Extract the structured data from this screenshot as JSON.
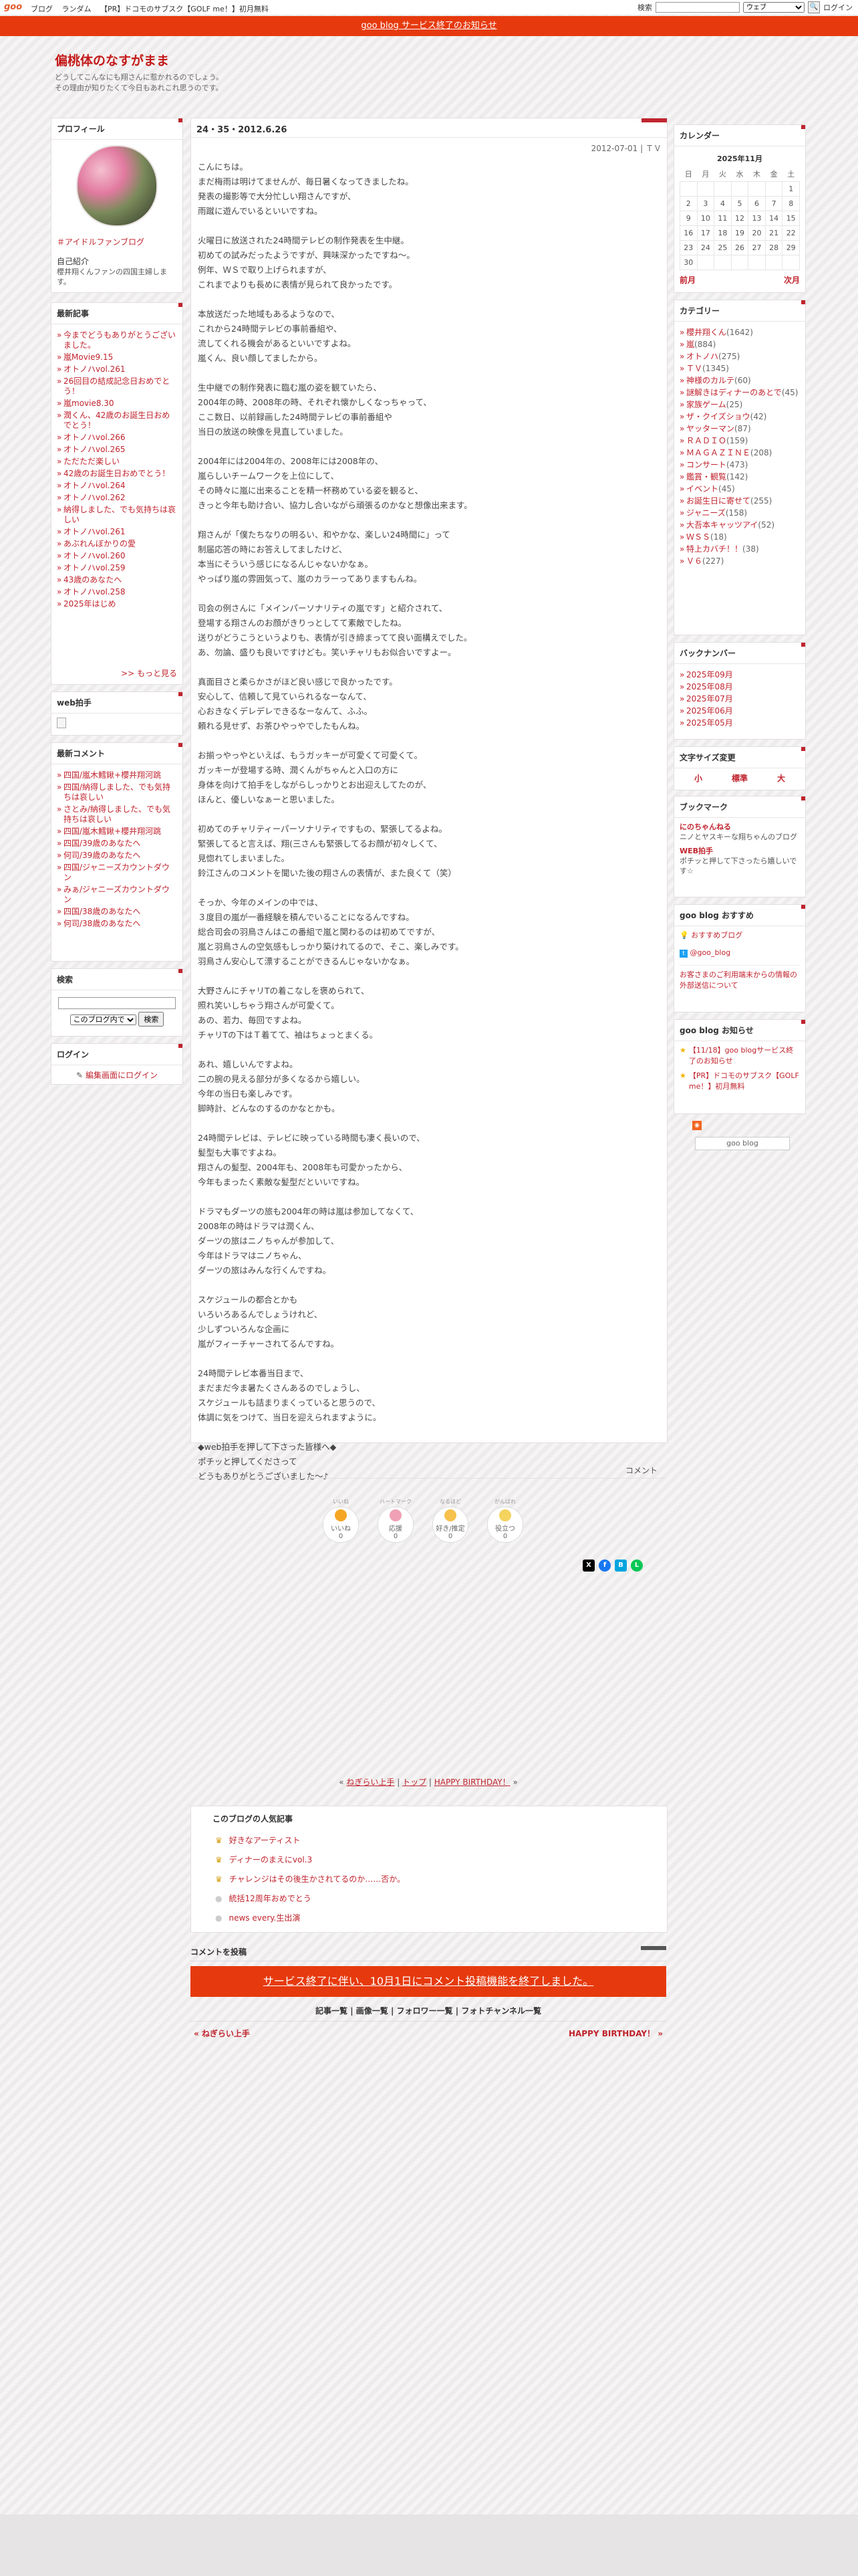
{
  "topbar": {
    "logo": "goo",
    "nav": [
      "ブログ",
      "ランダム",
      "【PR】ドコモのサブスク【GOLF me！】初月無料"
    ],
    "search_label": "検索",
    "search_scope": "ウェブ",
    "login": "ログイン"
  },
  "notice": "goo blog サービス終了のお知らせ",
  "blog": {
    "title": "偏桃体のなすがまま",
    "desc1": "どうしてこんなにも翔さんに惹かれるのでしょう。",
    "desc2": "その理由が知りたくて今日もあれこれ思うのです。"
  },
  "profile": {
    "heading": "プロフィール",
    "tag": "＃アイドルファンブログ",
    "intro_label": "自己紹介",
    "intro": "櫻井翔くんファンの四国主婦します。"
  },
  "recent": {
    "heading": "最新記事",
    "items": [
      "今までどうもありがとうございました。",
      "嵐Movie9.15",
      "オトノハvol.261",
      "26回目の結成記念日おめでとう！",
      "嵐movie8.30",
      "潤くん、42歳のお誕生日おめでとう！",
      "オトノハvol.266",
      "オトノハvol.265",
      "ただただ楽しい",
      "42歳のお誕生日おめでとう！",
      "オトノハvol.264",
      "オトノハvol.262",
      "納得しました、でも気持ちは哀しい",
      "オトノハvol.261",
      "あぶれんぼかりの愛",
      "オトノハvol.260",
      "オトノハvol.259",
      "43歳のあなたへ",
      "オトノハvol.258",
      "2025年はじめ"
    ],
    "more": ">> もっと見る"
  },
  "webclap": {
    "heading": "web拍手"
  },
  "comments": {
    "heading": "最新コメント",
    "items": [
      "四国/嵐木鱈鍬+櫻井翔河跳",
      "四国/納得しました、でも気持ちは哀しい",
      "さとみ/納得しました、でも気持ちは哀しい",
      "四国/嵐木鱈鍬+櫻井翔河跳",
      "四国/39歳のあなたへ",
      "何司/39歳のあなたへ",
      "四国/ジャニーズカウントダウン",
      "みぁ/ジャニーズカウントダウン",
      "四国/38歳のあなたへ",
      "何司/38歳のあなたへ"
    ]
  },
  "search": {
    "heading": "検索",
    "scope": "このブログ内で",
    "button": "検索"
  },
  "login": {
    "heading": "ログイン",
    "link": "編集画面にログイン"
  },
  "calendar": {
    "heading": "カレンダー",
    "month": "2025年11月",
    "days": [
      "日",
      "月",
      "火",
      "水",
      "木",
      "金",
      "土"
    ],
    "weeks": [
      [
        "",
        "",
        "",
        "",
        "",
        "",
        "1"
      ],
      [
        "2",
        "3",
        "4",
        "5",
        "6",
        "7",
        "8"
      ],
      [
        "9",
        "10",
        "11",
        "12",
        "13",
        "14",
        "15"
      ],
      [
        "16",
        "17",
        "18",
        "19",
        "20",
        "21",
        "22"
      ],
      [
        "23",
        "24",
        "25",
        "26",
        "27",
        "28",
        "29"
      ],
      [
        "30",
        "",
        "",
        "",
        "",
        "",
        ""
      ]
    ],
    "prev": "前月",
    "next": "次月"
  },
  "category": {
    "heading": "カテゴリー",
    "items": [
      {
        "name": "櫻井翔くん",
        "count": "(1642)"
      },
      {
        "name": "嵐",
        "count": "(884)"
      },
      {
        "name": "オトノハ",
        "count": "(275)"
      },
      {
        "name": "ＴＶ",
        "count": "(1345)"
      },
      {
        "name": "神様のカルテ",
        "count": "(60)"
      },
      {
        "name": "謎解きはディナーのあとで",
        "count": "(45)"
      },
      {
        "name": "家族ゲーム",
        "count": "(25)"
      },
      {
        "name": "ザ・クイズショウ",
        "count": "(42)"
      },
      {
        "name": "ヤッターマン",
        "count": "(87)"
      },
      {
        "name": "ＲＡＤＩＯ",
        "count": "(159)"
      },
      {
        "name": "ＭＡＧＡＺＩＮＥ",
        "count": "(208)"
      },
      {
        "name": "コンサート",
        "count": "(473)"
      },
      {
        "name": "鑑賞・観覧",
        "count": "(142)"
      },
      {
        "name": "イベント",
        "count": "(45)"
      },
      {
        "name": "お誕生日に寄せて",
        "count": "(255)"
      },
      {
        "name": "ジャニーズ",
        "count": "(158)"
      },
      {
        "name": "大吾本キャッツアイ",
        "count": "(52)"
      },
      {
        "name": "ＷＳＳ",
        "count": "(18)"
      },
      {
        "name": "特上カバチ！！",
        "count": "(38)"
      },
      {
        "name": "Ｖ６",
        "count": "(227)"
      }
    ]
  },
  "backnumber": {
    "heading": "バックナンバー",
    "items": [
      "2025年09月",
      "2025年08月",
      "2025年07月",
      "2025年06月",
      "2025年05月"
    ]
  },
  "fontsize": {
    "heading": "文字サイズ変更",
    "small": "小",
    "medium": "標準",
    "large": "大"
  },
  "bookmark": {
    "heading": "ブックマーク",
    "items": [
      {
        "name": "にのちゃんねる",
        "desc": "ニノとヤスキーな翔ちゃんのブログ"
      },
      {
        "name": "WEB拍手",
        "desc": "ポチッと押して下さったら嬉しいです☆"
      }
    ]
  },
  "recommend": {
    "heading": "goo blog おすすめ",
    "item1": "おすすめブログ",
    "item2": "@goo_blog",
    "notice": "お客さまのご利用端末からの情報の外部送信について"
  },
  "news": {
    "heading": "goo blog お知らせ",
    "items": [
      "【11/18】goo blogサービス終了のお知らせ",
      "【PR】ドコモのサブスク【GOLF me！】初月無料"
    ],
    "footer_badge": "goo blog"
  },
  "entry": {
    "title": "24・35・2012.6.26",
    "date": "2012-07-01 | ＴＶ",
    "paragraphs": [
      "こんにちは。\nまだ梅雨は明けてませんが、毎日暑くなってきましたね。\n発表の撮影等で大分忙しい翔さんですが、\n雨蹴に遊んでいるといいですね。",
      "火曜日に放送された24時間テレビの制作発表を生中継。\n初めての試みだったようですが、興味深かったですね～。\n例年、ＷＳで取り上げられますが、\nこれまでよりも長めに表情が見られて良かったです。",
      "本放送だった地域もあるようなので、\nこれから24時間テレビの事前番組や、\n流してくれる機会があるといいですよね。\n嵐くん、良い顔してましたから。",
      "生中継での制作発表に臨む嵐の姿を観ていたら、\n2004年の時、2008年の時、それぞれ懐かしくなっちゃって、\nここ数日、以前録画した24時間テレビの事前番組や\n当日の放送の映像を見直していました。",
      "2004年には2004年の、2008年には2008年の、\n嵐らしいチームワークを上位にして、\nその時々に嵐に出来ることを精一杯務めている姿を観ると、\nきっと今年も助け合い、協力し合いながら頑張るのかなと想像出来ます。",
      "翔さんが「僕たちなりの明るい、和やかな、楽しい24時間に」って\n制届応答の時にお答えしてましたけど、\n本当にそういう感じになるんじゃないかなぁ。\nやっぱり嵐の雰囲気って、嵐のカラーってありますもんね。",
      "司会の例さんに「メインパーソナリティの嵐です」と紹介されて、\n登場する翔さんのお顔がきりっとしてて素敵でしたね。\n送りがどうこうというよりも、表情が引き締まってて良い面構えでした。\nあ、勿論、盛りも良いですけども。笑いチャリもお似合いですよー。",
      "真面目さと柔らかさがほど良い感じで良かったです。\n安心して、信頼して見ていられるなーなんて、\n心おきなくデレデレできるなーなんて、ふふ。\n頼れる見せず、お茶ひやっやでしたもんね。",
      "お揃っやっやといえば、もうガッキーが可愛くて可愛くて。\nガッキーが登場する時、潤くんがちゃんと入口の方に\n身体を向けて拍手をしながらしっかりとお出迎えしてたのが、\nほんと、優しいなぁーと思いました。",
      "初めてのチャリティーパーソナリティですもの、緊張してるよね。\n緊張してると言えば、翔(三さんも緊張してるお顔が初々しくて、\n見惚れてしまいました。\n鈴江さんのコメントを聞いた後の翔さんの表情が、また良くて（笑）",
      "そっか、今年のメインの中では、\n３度目の嵐が一番経験を積んでいることになるんですね。\n総合司会の羽鳥さんはこの番組で嵐と関わるのは初めてですが、\n嵐と羽鳥さんの空気感もしっかり築けれてるので、そこ、楽しみです。\n羽鳥さん安心して漂することができるんじゃないかなぁ。",
      "大野さんにチャリTの着こなしを褒められて、\n照れ笑いしちゃう翔さんが可愛くて。\nあの、若力、毎回ですよね。\nチャリTの下はＴ着てて、袖はちょっとまくる。",
      "あれ、嬉しいんですよね。\n二の腕の見える部分が多くなるから嬉しい。\n今年の当日も楽しみです。\n脚時計、どんなのするのかなとかも。",
      "24時間テレビは、テレビに映っている時間も凄く長いので、\n髪型も大事ですよね。\n翔さんの髪型、2004年も、2008年も可愛かったから、\n今年もまったく素敵な髪型だといいですね。",
      "ドラマもダーツの旅も2004年の時は嵐は参加してなくて、\n2008年の時はドラマは潤くん、\nダーツの旅はニノちゃんが参加して、\n今年はドラマはニノちゃん、\nダーツの旅はみんな行くんですね。",
      "スケジュールの都合とかも\nいろいろあるんでしょうけれど、\n少しずついろんな企画に\n嵐がフィーチャーされてるんですね。",
      "24時間テレビ本番当日まで、\nまだまだ今ま暑たくさんあるのでしょうし、\nスケジュールも詰まりまくっていると思うので、\n体調に気をつけて、当日を迎えられますように。",
      "◆web拍手を押して下さった皆様へ◆\nポチッと押してくださって\nどうもありがとうございました～♪"
    ],
    "comment_link": "コメント"
  },
  "reactions": [
    {
      "sub": "いいね",
      "label": "いいね",
      "count": "0"
    },
    {
      "sub": "ハートマーク",
      "label": "応援",
      "count": "0"
    },
    {
      "sub": "なるほど",
      "label": "好き/推定",
      "count": "0"
    },
    {
      "sub": "がんばれ",
      "label": "役立つ",
      "count": "0"
    }
  ],
  "pager": {
    "prev": "ねぎらい上手",
    "top": "トップ",
    "next": "HAPPY BIRTHDAY！"
  },
  "popular": {
    "heading": "このブログの人気記事",
    "items": [
      "好きなアーティスト",
      "ディナーのまえにvol.3",
      "チャレンジはその後生かされてるのか……否か。",
      "統括12周年おめでとう",
      "news every.生出演"
    ]
  },
  "post": {
    "heading": "コメントを投稿",
    "notice": "サービス終了に伴い、10月1日にコメント投稿機能を終了しました。",
    "links": [
      "記事一覧",
      "画像一覧",
      "フォロワー一覧",
      "フォトチャンネル一覧"
    ],
    "prev": "« ねぎらい上手",
    "next": "HAPPY BIRTHDAY！ »"
  },
  "colors": {
    "accent": "#c0242e",
    "notice": "#e63a0e"
  }
}
